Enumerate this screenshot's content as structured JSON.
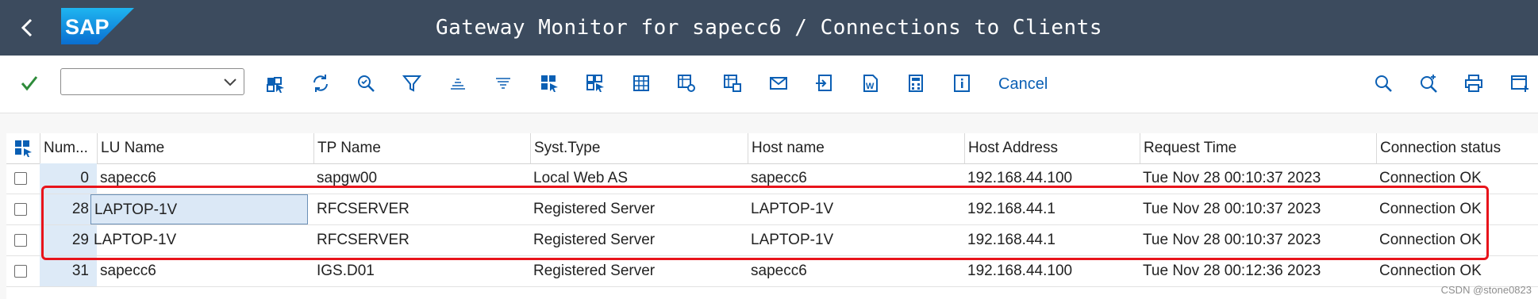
{
  "window": {
    "title": "Gateway Monitor for sapecc6 / Connections to Clients",
    "logo_text": "SAP"
  },
  "toolbar": {
    "command_field_value": "",
    "cancel_label": "Cancel",
    "colors": {
      "accent": "#0a5fb4",
      "ok_green": "#2e8b3a"
    }
  },
  "table": {
    "columns": [
      "Num...",
      "LU Name",
      "TP Name",
      "Syst.Type",
      "Host name",
      "Host Address",
      "Request Time",
      "Connection status"
    ],
    "rows": [
      {
        "num": "0",
        "lu": "sapecc6",
        "tp": "sapgw00",
        "type": "Local Web AS",
        "host": "sapecc6",
        "addr": "192.168.44.100",
        "time": "Tue Nov 28 00:10:37 2023",
        "status": "Connection OK"
      },
      {
        "num": "28",
        "lu": "LAPTOP-1V",
        "tp": "RFCSERVER",
        "type": "Registered Server",
        "host": "LAPTOP-1V",
        "addr": "192.168.44.1",
        "time": "Tue Nov 28 00:10:37 2023",
        "status": "Connection OK"
      },
      {
        "num": "29",
        "lu": "LAPTOP-1V",
        "tp": "RFCSERVER",
        "type": "Registered Server",
        "host": "LAPTOP-1V",
        "addr": "192.168.44.1",
        "time": "Tue Nov 28 00:10:37 2023",
        "status": "Connection OK"
      },
      {
        "num": "31",
        "lu": "sapecc6",
        "tp": "IGS.D01",
        "type": "Registered Server",
        "host": "sapecc6",
        "addr": "192.168.44.100",
        "time": "Tue Nov 28 00:12:36 2023",
        "status": "Connection OK"
      }
    ]
  },
  "watermark": "CSDN @stone0823",
  "highlight_color": "#e8141b",
  "header_bg": "#3c4b5e"
}
